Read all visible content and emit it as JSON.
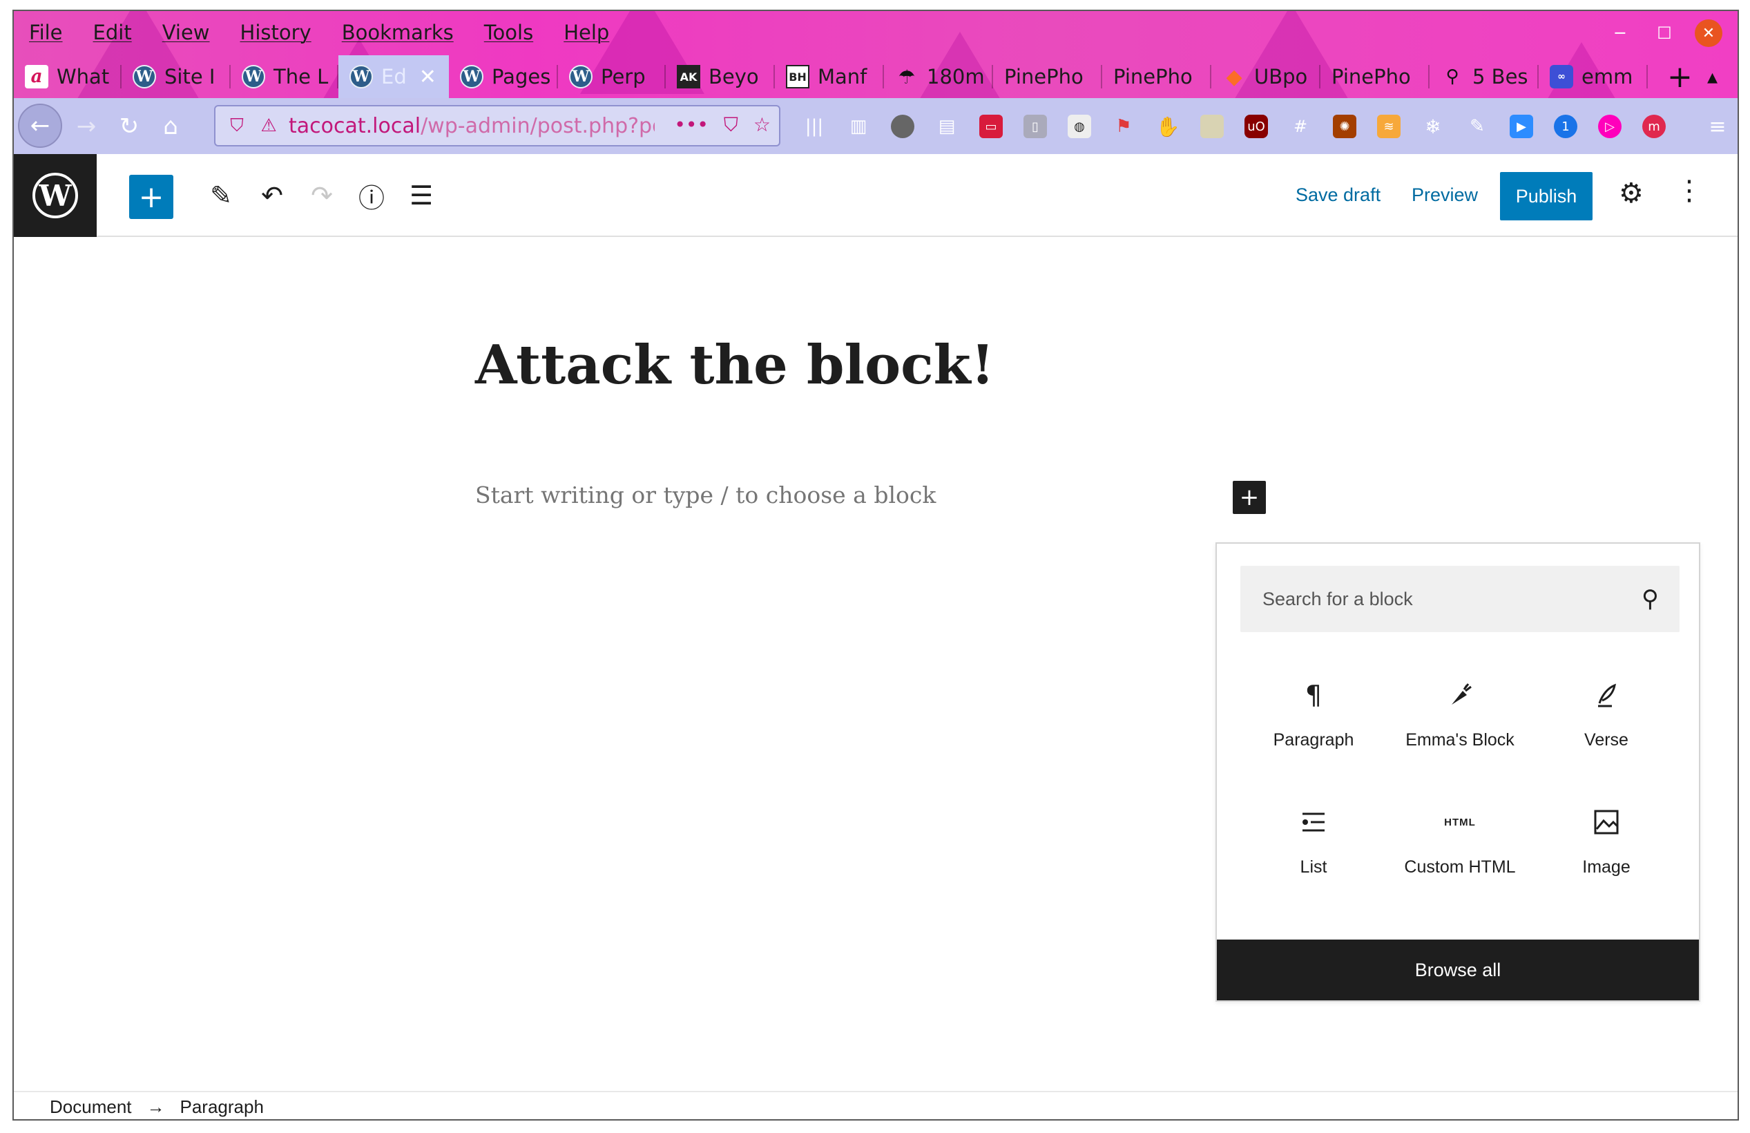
{
  "menubar": {
    "items": [
      "File",
      "Edit",
      "View",
      "History",
      "Bookmarks",
      "Tools",
      "Help"
    ]
  },
  "tabs": [
    {
      "label": "What",
      "icon": "acrobat-icon"
    },
    {
      "label": "Site I",
      "icon": "wordpress-icon"
    },
    {
      "label": "The L",
      "icon": "wordpress-icon"
    },
    {
      "label": "Ed",
      "icon": "wordpress-icon",
      "active": true
    },
    {
      "label": "Pages",
      "icon": "wordpress-icon"
    },
    {
      "label": "Perp",
      "icon": "wordpress-icon"
    },
    {
      "label": "Beyo",
      "icon": "ak-icon",
      "badge": "AK"
    },
    {
      "label": "Manf",
      "icon": "bh-icon",
      "badge": "BH"
    },
    {
      "label": "180m",
      "icon": "umbrella-icon"
    },
    {
      "label": "PinePho",
      "icon": "none"
    },
    {
      "label": "PinePho",
      "icon": "none"
    },
    {
      "label": "UBpo",
      "icon": "gitlab-icon"
    },
    {
      "label": "PinePho",
      "icon": "none"
    },
    {
      "label": "5 Bes",
      "icon": "telescope-icon"
    },
    {
      "label": "emm",
      "icon": "blog-icon"
    }
  ],
  "urlbar": {
    "host": "tacocat.local",
    "path": "/wp-admin/post.php?pos"
  },
  "editor": {
    "toolbar": {
      "save_draft": "Save draft",
      "preview": "Preview",
      "publish": "Publish"
    },
    "post_title": "Attack the block!",
    "placeholder": "Start writing or type / to choose a block"
  },
  "inserter": {
    "search_placeholder": "Search for a block",
    "blocks": [
      {
        "label": "Paragraph",
        "icon": "paragraph-icon"
      },
      {
        "label": "Emma's Block",
        "icon": "carrot-icon"
      },
      {
        "label": "Verse",
        "icon": "quill-icon"
      },
      {
        "label": "List",
        "icon": "list-icon"
      },
      {
        "label": "Custom HTML",
        "icon": "html-icon",
        "icon_text": "HTML"
      },
      {
        "label": "Image",
        "icon": "image-icon"
      }
    ],
    "browse_all": "Browse all"
  },
  "breadcrumb": {
    "items": [
      "Document",
      "Paragraph"
    ],
    "separator": "→"
  },
  "colors": {
    "wp_blue": "#007cba",
    "dark": "#1e1e1e",
    "browser_theme": "#ef39c2",
    "url_pink": "#c2177a"
  }
}
